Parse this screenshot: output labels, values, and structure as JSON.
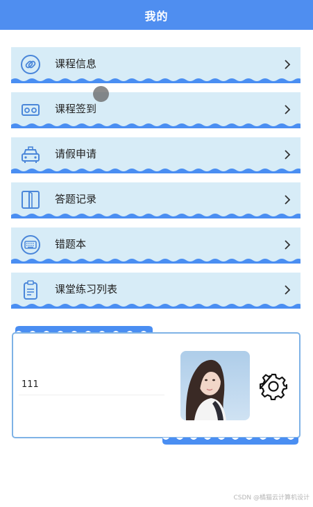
{
  "header": {
    "title": "我的"
  },
  "menu": [
    {
      "label": "课程信息",
      "icon": "link-icon"
    },
    {
      "label": "课程签到",
      "icon": "vr-goggles-icon"
    },
    {
      "label": "请假申请",
      "icon": "car-icon"
    },
    {
      "label": "答题记录",
      "icon": "book-icon"
    },
    {
      "label": "错题本",
      "icon": "keyboard-icon"
    },
    {
      "label": "课堂练习列表",
      "icon": "clipboard-icon"
    }
  ],
  "profile": {
    "username": "111",
    "settings_icon": "gear-icon"
  },
  "watermark": "CSDN @橘猫云计算机设计",
  "colors": {
    "header_bg": "#4f8ef0",
    "item_bg": "#d7ecf7",
    "wave": "#4a8ef2",
    "card_border": "#7eb2e6"
  }
}
